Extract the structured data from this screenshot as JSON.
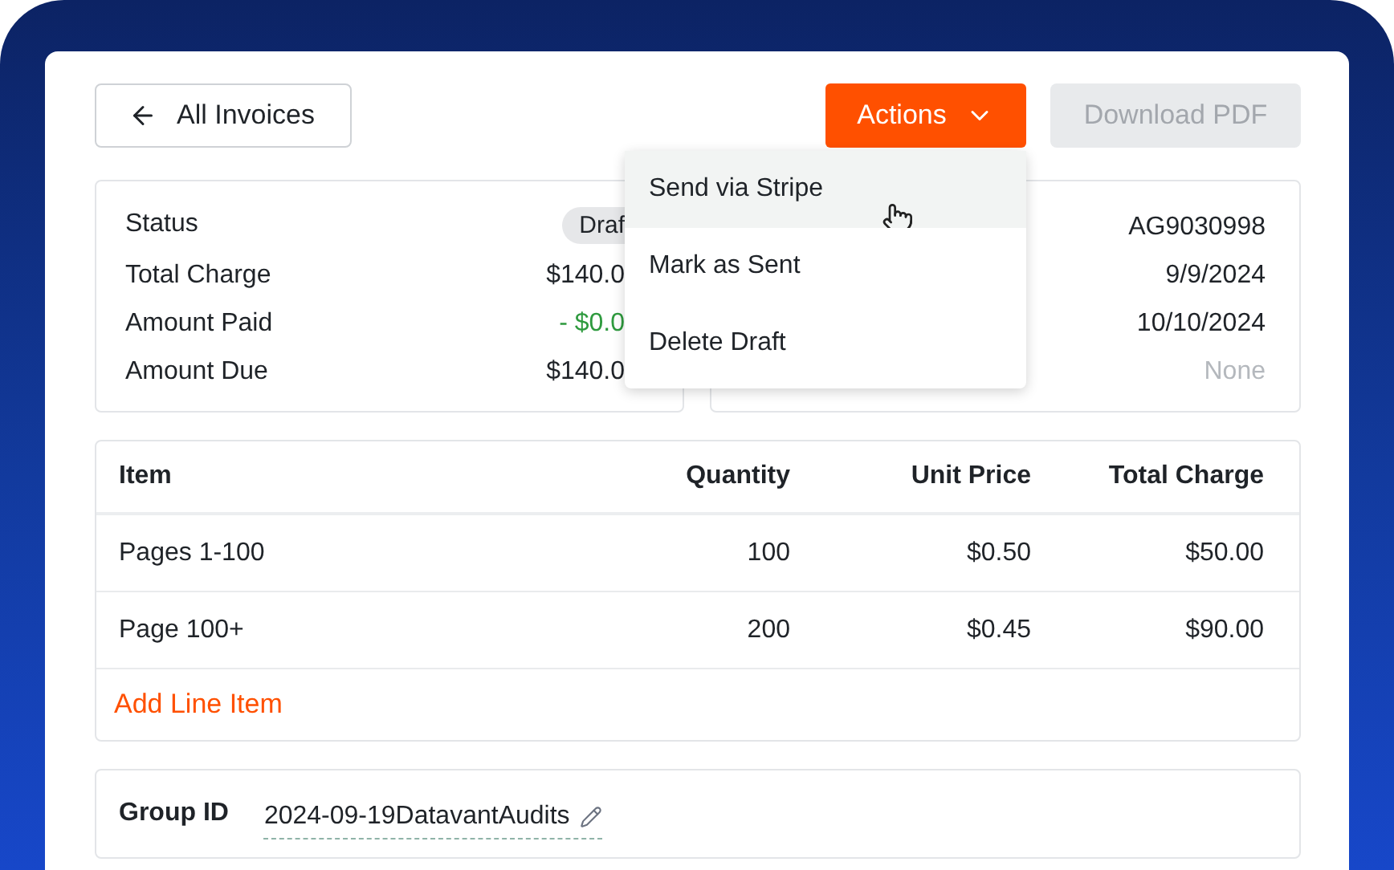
{
  "back_button": {
    "label": "All Invoices"
  },
  "actions_button": {
    "label": "Actions",
    "expanded": true
  },
  "download_button": {
    "label": "Download PDF",
    "disabled": true
  },
  "actions_menu": [
    {
      "label": "Send via Stripe",
      "highlighted": true
    },
    {
      "label": "Mark as Sent",
      "highlighted": false
    },
    {
      "label": "Delete Draft",
      "highlighted": false
    }
  ],
  "summary": [
    {
      "label": "Status",
      "value": "Draf",
      "kind": "chip"
    },
    {
      "label": "Total Charge",
      "value": "$140.0",
      "kind": "amount"
    },
    {
      "label": "Amount Paid",
      "value": "- $0.0",
      "kind": "credit"
    },
    {
      "label": "Amount Due",
      "value": "$140.0",
      "kind": "amount"
    }
  ],
  "details": [
    {
      "value": "AG9030998",
      "kind": "text"
    },
    {
      "value": "9/9/2024",
      "kind": "text"
    },
    {
      "value": "10/10/2024",
      "kind": "text"
    },
    {
      "value": "None",
      "kind": "empty"
    }
  ],
  "table": {
    "columns": [
      "Item",
      "Quantity",
      "Unit Price",
      "Total Charge"
    ],
    "rows": [
      [
        "Pages 1-100",
        "100",
        "$0.50",
        "$50.00"
      ],
      [
        "Page 100+",
        "200",
        "$0.45",
        "$90.00"
      ]
    ],
    "add_link": "Add Line Item"
  },
  "group_id": {
    "label": "Group ID",
    "value": "2024-09-19DatavantAudits"
  }
}
